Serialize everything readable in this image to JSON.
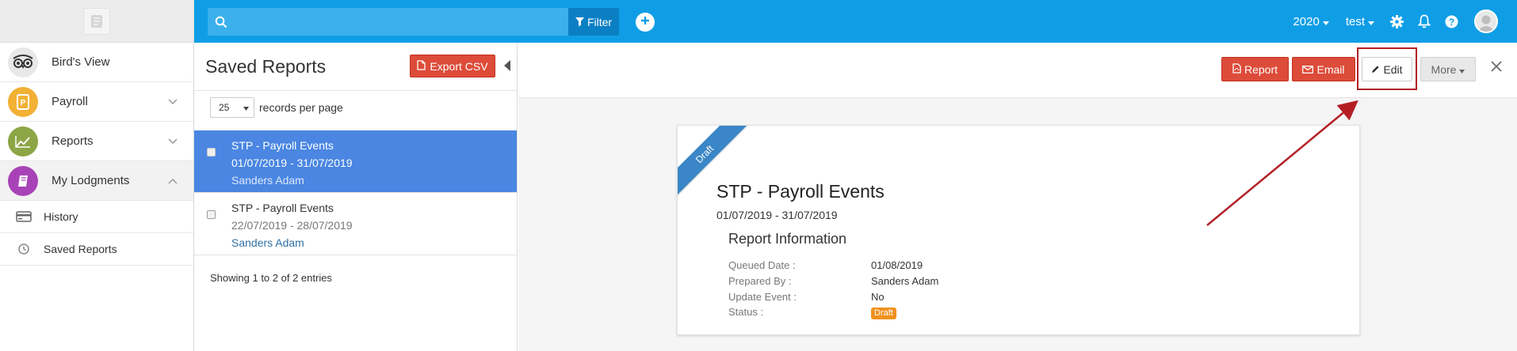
{
  "sidebar": {
    "logo_alt": "logo",
    "items": [
      {
        "label": "Bird's View",
        "icon": "owl-icon",
        "color": "#4a4a4a",
        "has_chevron": false
      },
      {
        "label": "Payroll",
        "icon": "payroll-doc-icon",
        "color": "#f2b134",
        "chevron": "down"
      },
      {
        "label": "Reports",
        "icon": "chart-icon",
        "color": "#8ca545",
        "chevron": "down"
      },
      {
        "label": "My Lodgments",
        "icon": "book-icon",
        "color": "#a843b7",
        "chevron": "up"
      }
    ],
    "subitems": [
      {
        "label": "History",
        "icon": "card-icon"
      },
      {
        "label": "Saved Reports",
        "icon": "clock-icon"
      }
    ]
  },
  "topbar": {
    "search_placeholder": "",
    "filter_label": "Filter",
    "year_label": "2020",
    "user_label": "test",
    "bg_color": "#0f9ee6"
  },
  "saved_reports": {
    "title": "Saved Reports",
    "export_label": "Export CSV",
    "page_size": "25",
    "records_per_page_label": "records per page",
    "rows": [
      {
        "name": "STP - Payroll Events",
        "range": "01/07/2019 - 31/07/2019",
        "person": "Sanders Adam",
        "selected": true
      },
      {
        "name": "STP - Payroll Events",
        "range": "22/07/2019 - 28/07/2019",
        "person": "Sanders Adam",
        "selected": false
      }
    ],
    "showing_text": "Showing 1 to 2 of 2 entries"
  },
  "detail": {
    "buttons": {
      "report_label": "Report",
      "email_label": "Email",
      "edit_label": "Edit",
      "more_label": "More"
    },
    "ribbon_label": "Draft",
    "card_title": "STP - Payroll Events",
    "card_range": "01/07/2019 - 31/07/2019",
    "info_title": "Report Information",
    "info": [
      {
        "key": "Queued Date :",
        "value": "01/08/2019"
      },
      {
        "key": "Prepared By :",
        "value": "Sanders Adam"
      },
      {
        "key": "Update Event :",
        "value": "No"
      },
      {
        "key": "Status :",
        "value": "Draft"
      }
    ],
    "annotation_color": "#b31f25"
  }
}
